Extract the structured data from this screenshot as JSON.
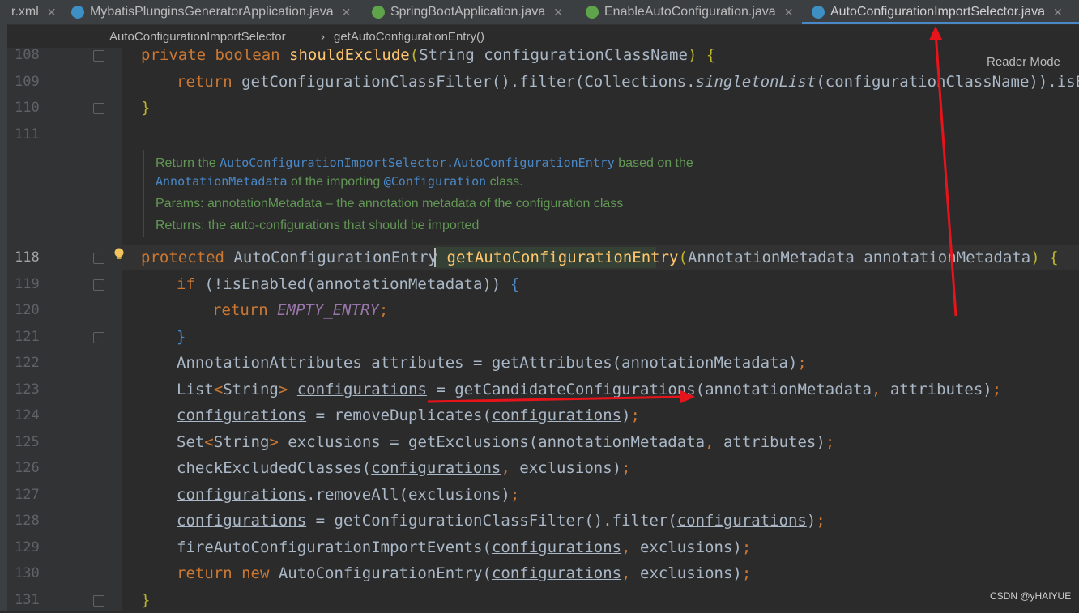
{
  "tabs": [
    {
      "label": "r.xml",
      "close": "✕",
      "icon": "xml-icon"
    },
    {
      "label": "MybatisPlunginsGeneratorApplication.java",
      "close": "✕",
      "icon": "spring-app-icon"
    },
    {
      "label": "SpringBootApplication.java",
      "close": "✕",
      "icon": "annotation-icon"
    },
    {
      "label": "EnableAutoConfiguration.java",
      "close": "✕",
      "icon": "annotation-icon"
    },
    {
      "label": "AutoConfigurationImportSelector.java",
      "close": "✕",
      "icon": "class-icon",
      "active": true
    }
  ],
  "breadcrumb": {
    "class": "AutoConfigurationImportSelector",
    "sep": "›",
    "method": "getAutoConfigurationEntry()"
  },
  "reader_mode": "Reader Mode",
  "watermark": "CSDN @yHAIYUE",
  "lines": {
    "108": "108",
    "109": "109",
    "110": "110",
    "111": "111",
    "118": "118",
    "119": "119",
    "120": "120",
    "121": "121",
    "122": "122",
    "123": "123",
    "124": "124",
    "125": "125",
    "126": "126",
    "127": "127",
    "128": "128",
    "129": "129",
    "130": "130",
    "131": "131"
  },
  "doc": {
    "l1a": "Return the ",
    "l1b": "AutoConfigurationImportSelector.AutoConfigurationEntry",
    "l1c": " based on the",
    "l2a": "AnnotationMetadata",
    "l2b": " of the importing ",
    "l2c": "@Configuration",
    "l2d": " class.",
    "l3": "Params:  annotationMetadata – the annotation metadata of the configuration class",
    "l4": "Returns:  the auto-configurations that should be imported"
  },
  "accent_colors": {
    "keyword": "#cc7832",
    "method": "#ffc66d",
    "text": "#a9b7c6",
    "annotation_arrow": "#e8141b"
  }
}
